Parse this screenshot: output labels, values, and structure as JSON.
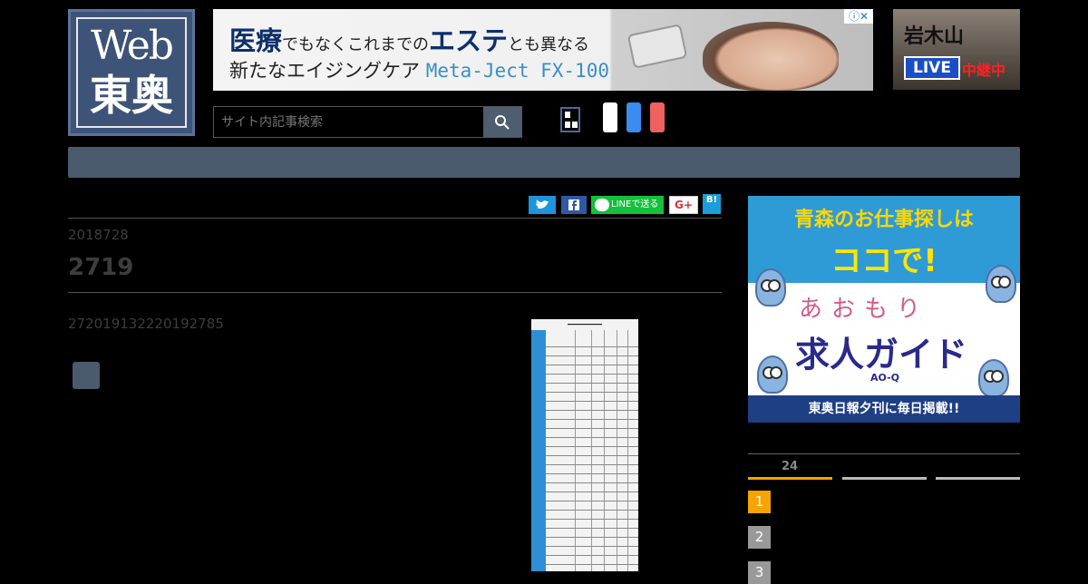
{
  "logo": {
    "line1": "Web",
    "line2": "東奥"
  },
  "ad_banner": {
    "word_medical": "医療",
    "copy1_mid": "でもなくこれまでの",
    "word_esthe": "エステ",
    "copy1_end": "とも異なる",
    "copy2": "新たなエイジングケア",
    "product": "Meta-Ject FX-100",
    "close_label": "ⓘ✕"
  },
  "live_box": {
    "mountain": "岩木山",
    "live_label": "LIVE",
    "relay_label": "中継中"
  },
  "search": {
    "placeholder": "サイト内記事検索"
  },
  "share": {
    "line_label": "LINEで送る",
    "gplus_label": "G+",
    "hatena_label": "B!"
  },
  "article": {
    "date": "2018728",
    "title": "2719",
    "body": "272019132220192785"
  },
  "side_ad": {
    "headline1": "青森のお仕事探しは",
    "headline2": "ココで!",
    "kana": "あおもり",
    "guide": "求人ガイド",
    "brand": "AO-Q",
    "footer": "東奥日報夕刊に毎日掲載!!"
  },
  "ranking": {
    "label": "24",
    "items": [
      "1",
      "2",
      "3"
    ]
  },
  "colors": {
    "nav": "#4b5a6d",
    "accent": "#f5a400",
    "twitter": "#1d95dc",
    "facebook": "#2d5aa3",
    "line": "#15c03a"
  }
}
